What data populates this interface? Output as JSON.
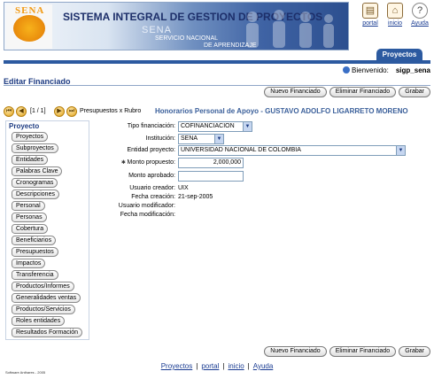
{
  "header": {
    "logo_text": "SENA",
    "title": "SISTEMA INTEGRAL DE GESTION DE PROYECTOS",
    "subtitle_org": "SENA",
    "subtitle_line1": "SERVICIO NACIONAL",
    "subtitle_line2": "DE APRENDIZAJE"
  },
  "top_links": [
    {
      "label": "portal",
      "icon": "portal-book-icon"
    },
    {
      "label": "inicio",
      "icon": "home-book-icon"
    },
    {
      "label": "Ayuda",
      "icon": "help-icon"
    }
  ],
  "active_tab": "Proyectos",
  "welcome": {
    "label": "Bienvenido:",
    "user": "sigp_sena"
  },
  "page_title": "Editar Financiado",
  "toolbar": {
    "new_label": "Nuevo Financiado",
    "delete_label": "Eliminar Financiado",
    "save_label": "Grabar"
  },
  "record_nav": {
    "position": "[1 / 1]",
    "context": "Presupuestos x Rubro",
    "heading": "Honorarios Personal de Apoyo - GUSTAVO ADOLFO LIGARRETO MORENO"
  },
  "sidebar": {
    "heading": "Proyecto",
    "items": [
      "Proyectos",
      "Subproyectos",
      "Entidades",
      "Palabras Clave",
      "Cronogramas",
      "Descripciones",
      "Personal",
      "Personas",
      "Cobertura",
      "Beneficiarios",
      "Presupuestos",
      "Impactos",
      "Transferencia",
      "Productos/Informes",
      "Generalidades ventas",
      "Productos/Servicios",
      "Roles entidades",
      "Resultados Formación"
    ]
  },
  "form": {
    "tipo_financiacion": {
      "label": "Tipo financiación:",
      "value": "COFINANCIACION"
    },
    "institucion": {
      "label": "Institución:",
      "value": "SENA"
    },
    "entidad_proyecto": {
      "label": "Entidad proyecto:",
      "value": "UNIVERSIDAD NACIONAL DE COLOMBIA"
    },
    "monto_propuesto": {
      "label": "Monto propuesto:",
      "value": "2,000,000"
    },
    "monto_aprobado": {
      "label": "Monto aprobado:",
      "value": ""
    },
    "usuario_creador": {
      "label": "Usuario creador:",
      "value": "UIX"
    },
    "fecha_creacion": {
      "label": "Fecha creación:",
      "value": "21-sep-2005"
    },
    "usuario_modificador": {
      "label": "Usuario modificador:",
      "value": ""
    },
    "fecha_modificacion": {
      "label": "Fecha modificación:",
      "value": ""
    }
  },
  "footer_links": [
    "Proyectos",
    "portal",
    "inicio",
    "Ayuda"
  ],
  "copyright": "Software Anthares - 2005",
  "colors": {
    "accent": "#2c5aa0",
    "heading": "#1d3b82",
    "nav_heading": "#3a5f9a"
  }
}
